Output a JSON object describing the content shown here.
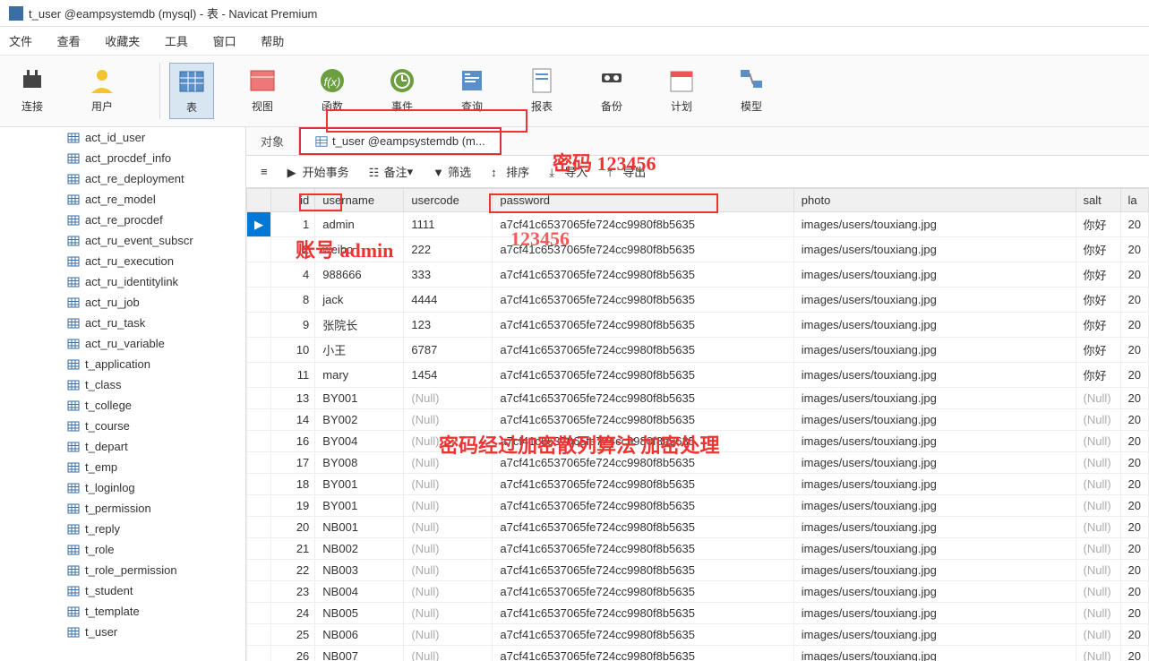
{
  "window": {
    "title": "t_user @eampsystemdb (mysql) - 表 - Navicat Premium"
  },
  "menu": {
    "items": [
      "文件",
      "查看",
      "收藏夹",
      "工具",
      "窗口",
      "帮助"
    ]
  },
  "toolbar": {
    "items": [
      {
        "label": "连接",
        "icon": "plug"
      },
      {
        "label": "用户",
        "icon": "user"
      },
      {
        "label": "表",
        "icon": "table",
        "active": true
      },
      {
        "label": "视图",
        "icon": "view"
      },
      {
        "label": "函数",
        "icon": "fx"
      },
      {
        "label": "事件",
        "icon": "event"
      },
      {
        "label": "查询",
        "icon": "query"
      },
      {
        "label": "报表",
        "icon": "report"
      },
      {
        "label": "备份",
        "icon": "backup"
      },
      {
        "label": "计划",
        "icon": "schedule"
      },
      {
        "label": "模型",
        "icon": "model"
      }
    ]
  },
  "sidebar": {
    "items": [
      "act_id_user",
      "act_procdef_info",
      "act_re_deployment",
      "act_re_model",
      "act_re_procdef",
      "act_ru_event_subscr",
      "act_ru_execution",
      "act_ru_identitylink",
      "act_ru_job",
      "act_ru_task",
      "act_ru_variable",
      "t_application",
      "t_class",
      "t_college",
      "t_course",
      "t_depart",
      "t_emp",
      "t_loginlog",
      "t_permission",
      "t_reply",
      "t_role",
      "t_role_permission",
      "t_student",
      "t_template",
      "t_user"
    ]
  },
  "tabs": {
    "object": "对象",
    "active": "t_user @eampsystemdb (m..."
  },
  "subtoolbar": {
    "start": "开始事务",
    "memo": "备注",
    "filter": "筛选",
    "sort": "排序",
    "import": "导入",
    "export": "导出"
  },
  "headers": {
    "id": "id",
    "username": "username",
    "usercode": "usercode",
    "password": "password",
    "photo": "photo",
    "salt": "salt",
    "last": "la"
  },
  "rows": [
    {
      "id": 1,
      "username": "admin",
      "usercode": "1111",
      "password": "a7cf41c6537065fe724cc9980f8b5635",
      "photo": "images/users/touxiang.jpg",
      "salt": "你好",
      "last": "20"
    },
    {
      "id": 2,
      "username": "weibo",
      "usercode": "222",
      "password": "a7cf41c6537065fe724cc9980f8b5635",
      "photo": "images/users/touxiang.jpg",
      "salt": "你好",
      "last": "20"
    },
    {
      "id": 4,
      "username": "988666",
      "usercode": "333",
      "password": "a7cf41c6537065fe724cc9980f8b5635",
      "photo": "images/users/touxiang.jpg",
      "salt": "你好",
      "last": "20"
    },
    {
      "id": 8,
      "username": "jack",
      "usercode": "4444",
      "password": "a7cf41c6537065fe724cc9980f8b5635",
      "photo": "images/users/touxiang.jpg",
      "salt": "你好",
      "last": "20"
    },
    {
      "id": 9,
      "username": "张院长",
      "usercode": "123",
      "password": "a7cf41c6537065fe724cc9980f8b5635",
      "photo": "images/users/touxiang.jpg",
      "salt": "你好",
      "last": "20"
    },
    {
      "id": 10,
      "username": "小王",
      "usercode": "6787",
      "password": "a7cf41c6537065fe724cc9980f8b5635",
      "photo": "images/users/touxiang.jpg",
      "salt": "你好",
      "last": "20"
    },
    {
      "id": 11,
      "username": "mary",
      "usercode": "1454",
      "password": "a7cf41c6537065fe724cc9980f8b5635",
      "photo": "images/users/touxiang.jpg",
      "salt": "你好",
      "last": "20"
    },
    {
      "id": 13,
      "username": "BY001",
      "usercode": null,
      "password": "a7cf41c6537065fe724cc9980f8b5635",
      "photo": "images/users/touxiang.jpg",
      "salt": null,
      "last": "20"
    },
    {
      "id": 14,
      "username": "BY002",
      "usercode": null,
      "password": "a7cf41c6537065fe724cc9980f8b5635",
      "photo": "images/users/touxiang.jpg",
      "salt": null,
      "last": "20"
    },
    {
      "id": 16,
      "username": "BY004",
      "usercode": null,
      "password": "a7cf41c6537065fe724cc9980f8b5635",
      "photo": "images/users/touxiang.jpg",
      "salt": null,
      "last": "20"
    },
    {
      "id": 17,
      "username": "BY008",
      "usercode": null,
      "password": "a7cf41c6537065fe724cc9980f8b5635",
      "photo": "images/users/touxiang.jpg",
      "salt": null,
      "last": "20"
    },
    {
      "id": 18,
      "username": "BY001",
      "usercode": null,
      "password": "a7cf41c6537065fe724cc9980f8b5635",
      "photo": "images/users/touxiang.jpg",
      "salt": null,
      "last": "20"
    },
    {
      "id": 19,
      "username": "BY001",
      "usercode": null,
      "password": "a7cf41c6537065fe724cc9980f8b5635",
      "photo": "images/users/touxiang.jpg",
      "salt": null,
      "last": "20"
    },
    {
      "id": 20,
      "username": "NB001",
      "usercode": null,
      "password": "a7cf41c6537065fe724cc9980f8b5635",
      "photo": "images/users/touxiang.jpg",
      "salt": null,
      "last": "20"
    },
    {
      "id": 21,
      "username": "NB002",
      "usercode": null,
      "password": "a7cf41c6537065fe724cc9980f8b5635",
      "photo": "images/users/touxiang.jpg",
      "salt": null,
      "last": "20"
    },
    {
      "id": 22,
      "username": "NB003",
      "usercode": null,
      "password": "a7cf41c6537065fe724cc9980f8b5635",
      "photo": "images/users/touxiang.jpg",
      "salt": null,
      "last": "20"
    },
    {
      "id": 23,
      "username": "NB004",
      "usercode": null,
      "password": "a7cf41c6537065fe724cc9980f8b5635",
      "photo": "images/users/touxiang.jpg",
      "salt": null,
      "last": "20"
    },
    {
      "id": 24,
      "username": "NB005",
      "usercode": null,
      "password": "a7cf41c6537065fe724cc9980f8b5635",
      "photo": "images/users/touxiang.jpg",
      "salt": null,
      "last": "20"
    },
    {
      "id": 25,
      "username": "NB006",
      "usercode": null,
      "password": "a7cf41c6537065fe724cc9980f8b5635",
      "photo": "images/users/touxiang.jpg",
      "salt": null,
      "last": "20"
    },
    {
      "id": 26,
      "username": "NB007",
      "usercode": null,
      "password": "a7cf41c6537065fe724cc9980f8b5635",
      "photo": "images/users/touxiang.jpg",
      "salt": null,
      "last": "20"
    }
  ],
  "annotations": {
    "a1": "密码 123456",
    "a2": "账号 admin",
    "a3": "123456",
    "a4": "密码经过加密散列算法 加密处理"
  },
  "nulltext": "(Null)"
}
